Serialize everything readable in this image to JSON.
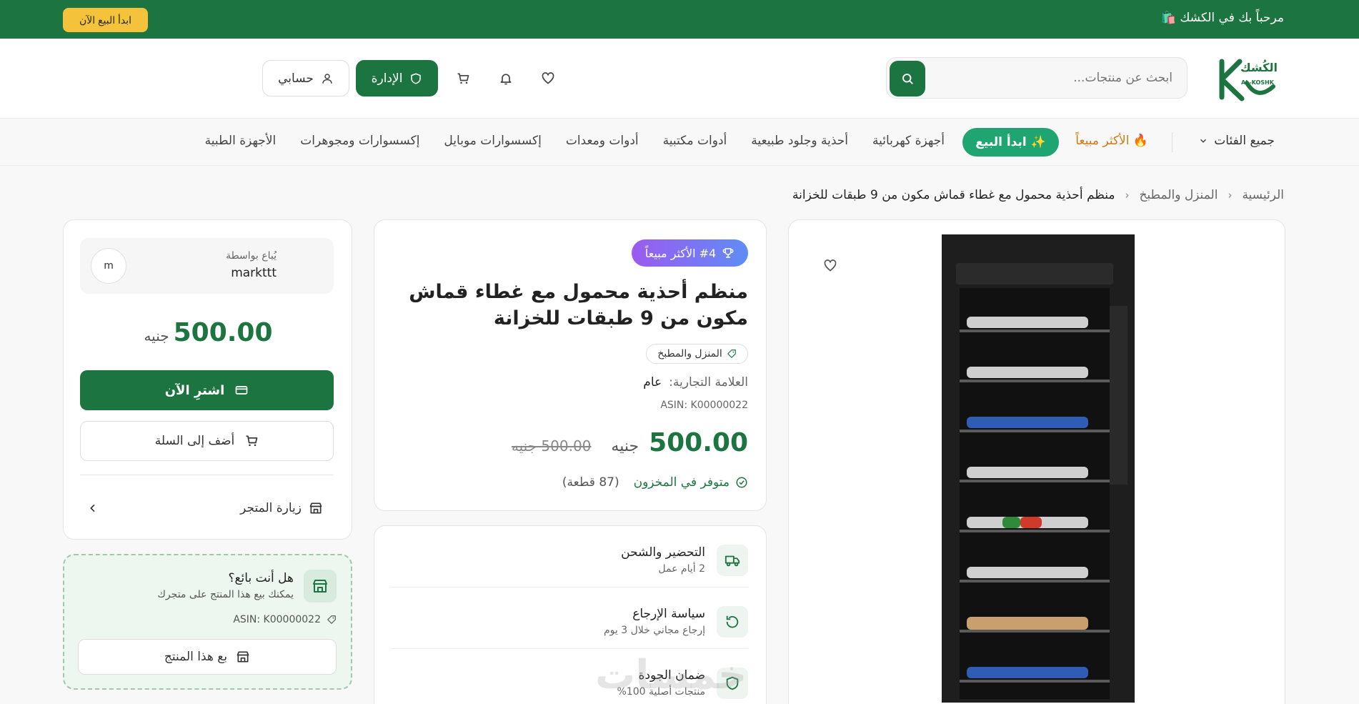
{
  "topbar": {
    "welcome": "مرحباً بك في الكشك 🛍️",
    "start_selling": "ابدأ البيع الآن"
  },
  "header": {
    "logo_text_ar": "الكُشك",
    "logo_text_en": "AL-KOSHK",
    "search_placeholder": "ابحث عن منتجات...",
    "admin_label": "الإدارة",
    "account_label": "حسابي"
  },
  "catnav": {
    "all_categories": "جميع الفئات",
    "best_sellers": "🔥 الأكثر مبيعاً",
    "start_selling": "✨ ابدأ البيع",
    "links": [
      "أجهزة كهربائية",
      "أحذية وجلود طبيعية",
      "أدوات مكتبية",
      "أدوات ومعدات",
      "إكسسوارات موبايل",
      "إكسسوارات ومجوهرات",
      "الأجهزة الطبية"
    ]
  },
  "breadcrumb": {
    "home": "الرئيسية",
    "category": "المنزل والمطبخ",
    "current": "منظم أحذية محمول مع غطاء قماش مكون من 9 طبقات للخزانة"
  },
  "product": {
    "rank_badge": "#4 الأكثر مبيعاً",
    "title": "منظم أحذية محمول مع غطاء قماش مكون من 9 طبقات للخزانة",
    "category": "المنزل والمطبخ",
    "brand_label": "العلامة التجارية:",
    "brand_value": "عام",
    "asin": "ASIN: K00000022",
    "price": "500.00",
    "currency": "جنيه",
    "old_price": "500.00 جنيه",
    "stock_status": "متوفر في المخزون",
    "stock_qty": "(87 قطعة)"
  },
  "services": [
    {
      "title": "التحضير والشحن",
      "subtitle": "2 أيام عمل"
    },
    {
      "title": "سياسة الإرجاع",
      "subtitle": "إرجاع مجاني خلال 3 يوم"
    },
    {
      "title": "ضمان الجودة",
      "subtitle": "منتجات أصلية 100%"
    }
  ],
  "watermark": "خمسات",
  "buybox": {
    "sold_by_label": "يُباع بواسطة",
    "seller_name": "markttt",
    "seller_initial": "m",
    "price": "500.00",
    "currency": "جنيه",
    "buy_now": "اشترِ الآن",
    "add_to_cart": "أضف إلى السلة",
    "visit_store": "زيارة المتجر"
  },
  "seller_cta": {
    "question": "هل أنت بائع؟",
    "description": "يمكنك بيع هذا المنتج على متجرك",
    "asin": "ASIN: K00000022",
    "sell_button": "بع هذا المنتج"
  },
  "colors": {
    "brand_green": "#1c7440",
    "accent_yellow": "#f5c23b",
    "sell_pill": "#1fa571"
  }
}
